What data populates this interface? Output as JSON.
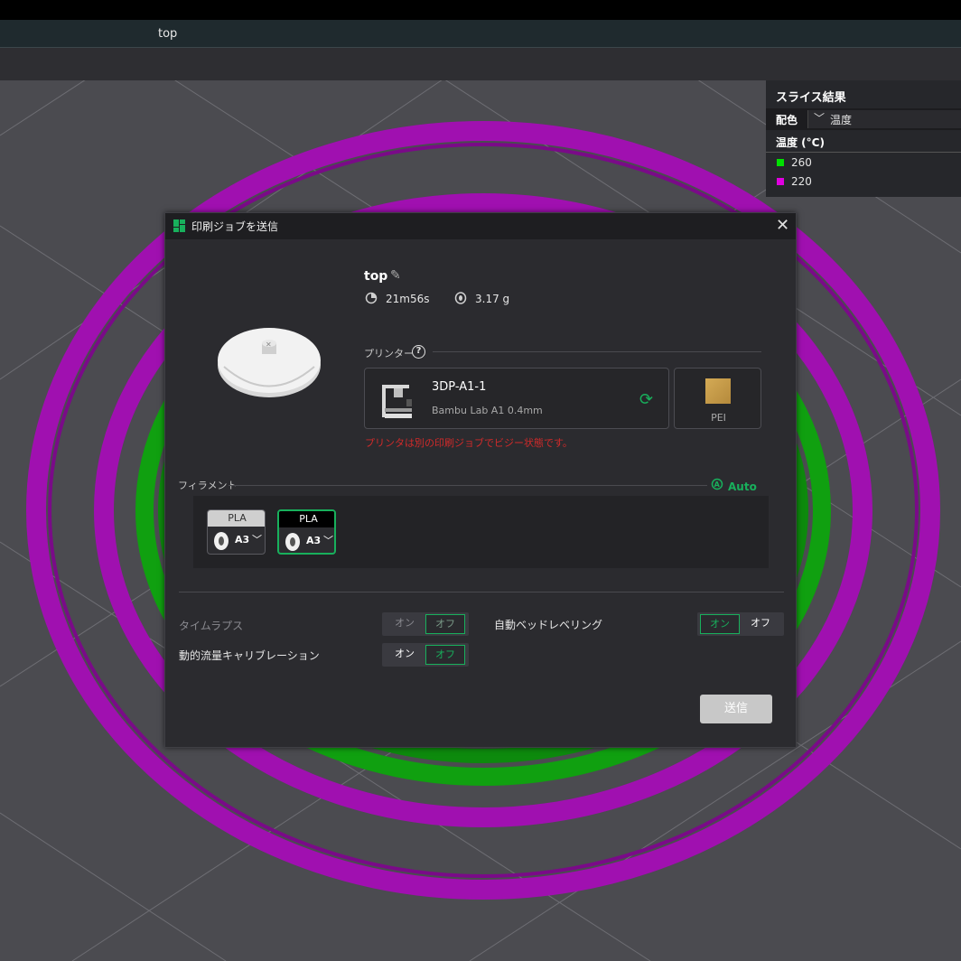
{
  "window": {
    "tab_title": "top"
  },
  "colors": {
    "accent": "#18b05c",
    "warning": "#d12a2a",
    "temp_260": "#00e000",
    "temp_220": "#e000e0",
    "filament_purple": "#a010b0",
    "filament_green": "#10a010"
  },
  "slice_panel": {
    "title": "スライス結果",
    "color_label": "配色",
    "color_mode": "温度",
    "legend_title": "温度 (°C)",
    "legend": [
      {
        "label": "260",
        "color": "#00e000"
      },
      {
        "label": "220",
        "color": "#e000e0"
      }
    ]
  },
  "dialog": {
    "title": "印刷ジョブを送信",
    "close_icon": "close-icon",
    "job_name": "top",
    "print_time": "21m56s",
    "filament_weight": "3.17 g",
    "printer_section_label": "プリンター",
    "printer": {
      "name": "3DP-A1-1",
      "model": "Bambu Lab A1  0.4mm",
      "plate": "PEI"
    },
    "busy_warning": "プリンタは別の印刷ジョブでビジー状態です。",
    "filament_section_label": "フィラメント",
    "auto_label": "Auto",
    "filaments": [
      {
        "type": "PLA",
        "slot": "A3",
        "selected": false
      },
      {
        "type": "PLA",
        "slot": "A3",
        "selected": true
      }
    ],
    "options": {
      "timelapse": {
        "label": "タイムラプス",
        "on": "オン",
        "off": "オフ",
        "value": "off",
        "enabled": false
      },
      "bed_leveling": {
        "label": "自動ベッドレベリング",
        "on": "オン",
        "off": "オフ",
        "value": "on",
        "enabled": true
      },
      "flow_calibration": {
        "label": "動的流量キャリブレーション",
        "on": "オン",
        "off": "オフ",
        "value": "off",
        "enabled": true
      }
    },
    "send_label": "送信"
  }
}
